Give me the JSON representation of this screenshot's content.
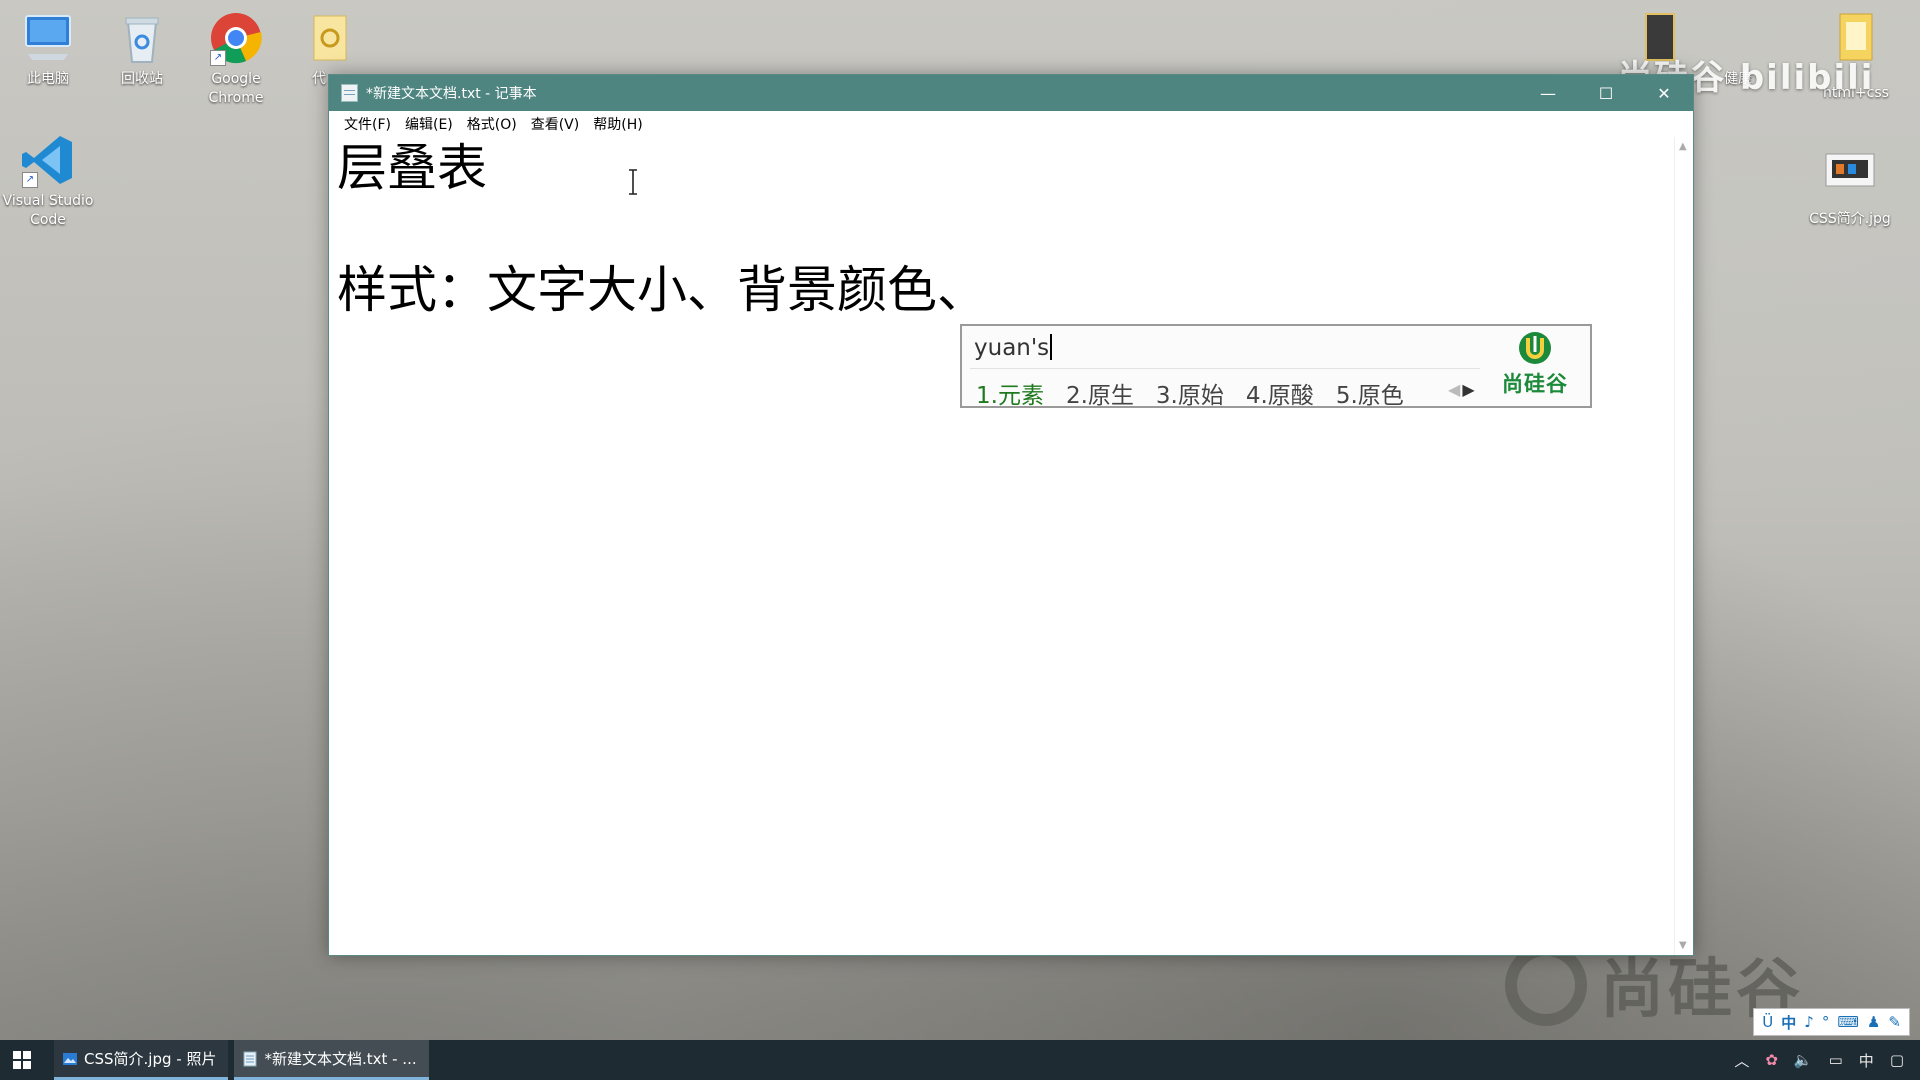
{
  "desktop": {
    "icons": [
      {
        "label": "此电脑",
        "icon": "computer-icon"
      },
      {
        "label": "回收站",
        "icon": "recycle-bin-icon"
      },
      {
        "label": "Google Chrome",
        "icon": "chrome-icon"
      },
      {
        "label": "代",
        "icon": "folder-icon"
      },
      {
        "label": "Visual Studio Code",
        "icon": "vscode-icon"
      },
      {
        "label": "健康",
        "icon": "folder-icon"
      },
      {
        "label": "html+css",
        "icon": "folder-icon"
      },
      {
        "label": "CSS简介.jpg",
        "icon": "image-file-icon"
      }
    ]
  },
  "notepad": {
    "title": "*新建文本文档.txt - 记事本",
    "menu": [
      "文件(F)",
      "编辑(E)",
      "格式(O)",
      "查看(V)",
      "帮助(H)"
    ],
    "lines": [
      "层叠表",
      "",
      "样式：文字大小、背景颜色、"
    ]
  },
  "ime": {
    "composition": "yuan's",
    "candidates": [
      "1.元素",
      "2.原生",
      "3.原始",
      "4.原酸",
      "5.原色"
    ],
    "brand": "尚硅谷"
  },
  "taskbar": {
    "items": [
      {
        "label": "CSS简介.jpg - 照片",
        "icon": "photos-icon"
      },
      {
        "label": "*新建文本文档.txt - ...",
        "icon": "notepad-icon"
      }
    ],
    "tray_input": "中"
  },
  "ime_statusbar": {
    "mode": "中"
  },
  "watermarks": {
    "top": "尚硅谷 bilibili",
    "bottom": "尚硅谷"
  },
  "colors": {
    "titlebar": "#4f8580",
    "taskbar": "#1f2b33",
    "ime_selected": "#1f7a1f"
  }
}
